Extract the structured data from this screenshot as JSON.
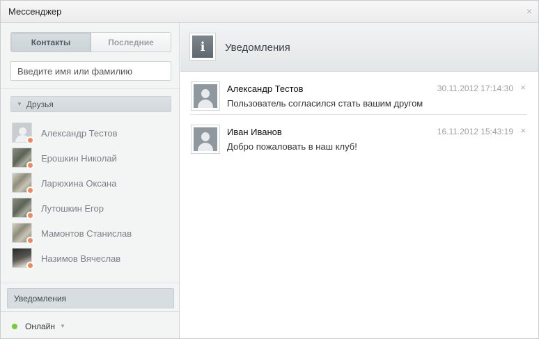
{
  "window": {
    "title": "Мессенджер",
    "close_glyph": "×"
  },
  "sidebar": {
    "tabs": [
      {
        "label": "Контакты",
        "active": true
      },
      {
        "label": "Последние",
        "active": false
      }
    ],
    "search": {
      "placeholder": "Введите имя или фамилию",
      "value": ""
    },
    "group": {
      "label": "Друзья",
      "caret_icon": "caret-down-icon"
    },
    "contacts": [
      {
        "name": "Александр Тестов",
        "avatar": "default",
        "status": "offline"
      },
      {
        "name": "Ерошкин Николай",
        "avatar": "photo",
        "status": "offline"
      },
      {
        "name": "Ларюхина Оксана",
        "avatar": "photo",
        "status": "offline"
      },
      {
        "name": "Лутошкин Егор",
        "avatar": "photo",
        "status": "offline"
      },
      {
        "name": "Мамонтов Станислав",
        "avatar": "photo",
        "status": "offline"
      },
      {
        "name": "Назимов Вячеслав",
        "avatar": "photo",
        "status": "offline"
      }
    ],
    "notifications_label": "Уведомления",
    "status": {
      "label": "Онлайн",
      "color": "#7cc63c"
    }
  },
  "main": {
    "heading": "Уведомления",
    "info_glyph": "i",
    "notifications": [
      {
        "name": "Александр Тестов",
        "text": "Пользователь согласился стать вашим другом",
        "time": "30.11.2012 17:14:30",
        "close_glyph": "×"
      },
      {
        "name": "Иван Иванов",
        "text": "Добро пожаловать в наш клуб!",
        "time": "16.11.2012 15:43:19",
        "close_glyph": "×"
      }
    ]
  },
  "colors": {
    "offline_status": "#f0885c",
    "online_status": "#7cc63c",
    "accent_panel": "#d7dde1"
  }
}
